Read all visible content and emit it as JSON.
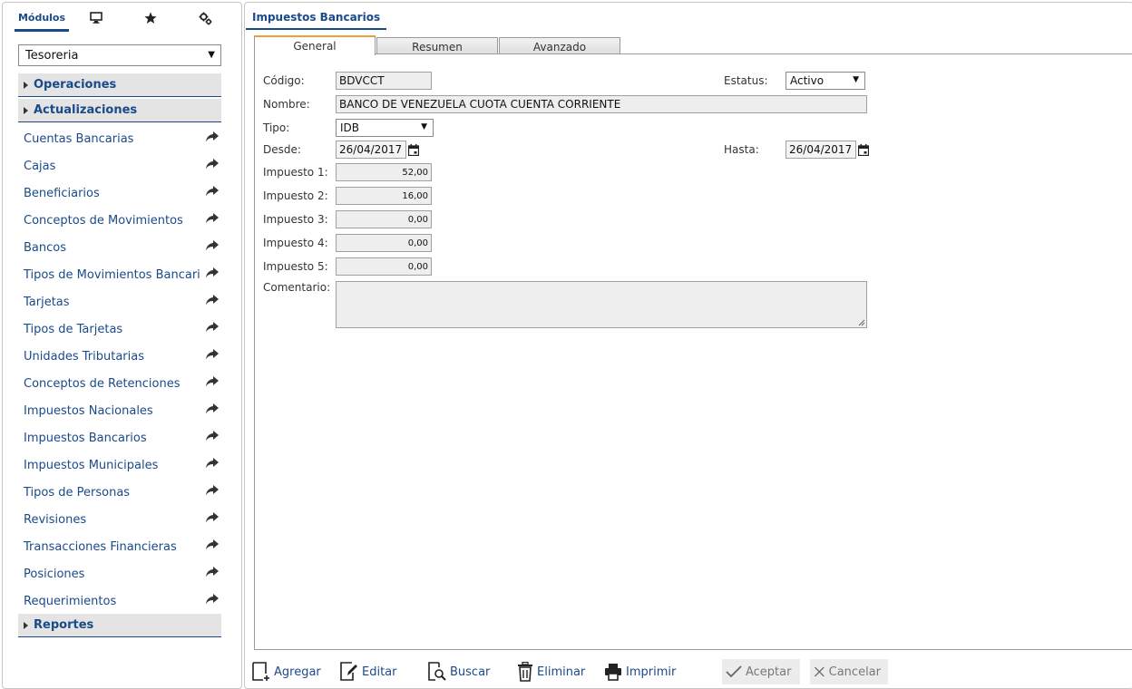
{
  "left_panel": {
    "tabs": {
      "modulos": "Módulos",
      "monitor_icon": "monitor-icon",
      "favorites_icon": "star-icon",
      "settings_icon": "gears-icon"
    },
    "module_select": {
      "value": "Tesoreria"
    },
    "sections": {
      "operaciones": "Operaciones",
      "actualizaciones": "Actualizaciones",
      "reportes": "Reportes"
    },
    "menu_items": [
      "Cuentas Bancarias",
      "Cajas",
      "Beneficiarios",
      "Conceptos de Movimientos",
      "Bancos",
      "Tipos de Movimientos Bancarios",
      "Tarjetas",
      "Tipos de Tarjetas",
      "Unidades Tributarias",
      "Conceptos de Retenciones",
      "Impuestos Nacionales",
      "Impuestos Bancarios",
      "Impuestos Municipales",
      "Tipos de Personas",
      "Revisiones",
      "Transacciones Financieras",
      "Posiciones",
      "Requerimientos"
    ]
  },
  "main": {
    "title": "Impuestos Bancarios",
    "tabs": {
      "general": "General",
      "resumen": "Resumen",
      "avanzado": "Avanzado"
    },
    "form": {
      "codigo_label": "Código:",
      "codigo_value": "BDVCCT",
      "estatus_label": "Estatus:",
      "estatus_value": "Activo",
      "nombre_label": "Nombre:",
      "nombre_value": "BANCO DE VENEZUELA CUOTA CUENTA CORRIENTE",
      "tipo_label": "Tipo:",
      "tipo_value": "IDB",
      "desde_label": "Desde:",
      "desde_value": "26/04/2017",
      "hasta_label": "Hasta:",
      "hasta_value": "26/04/2017",
      "impuesto1_label": "Impuesto 1:",
      "impuesto1_value": "52,00",
      "impuesto2_label": "Impuesto 2:",
      "impuesto2_value": "16,00",
      "impuesto3_label": "Impuesto 3:",
      "impuesto3_value": "0,00",
      "impuesto4_label": "Impuesto 4:",
      "impuesto4_value": "0,00",
      "impuesto5_label": "Impuesto 5:",
      "impuesto5_value": "0,00",
      "comentario_label": "Comentario:"
    },
    "toolbar": {
      "agregar": "Agregar",
      "editar": "Editar",
      "buscar": "Buscar",
      "eliminar": "Eliminar",
      "imprimir": "Imprimir",
      "aceptar": "Aceptar",
      "cancelar": "Cancelar"
    }
  },
  "colors": {
    "accent": "#1a4a8a",
    "active_tab_top": "#f0a030",
    "section_bg": "#e4e4e4",
    "field_bg": "#eeeeee"
  }
}
